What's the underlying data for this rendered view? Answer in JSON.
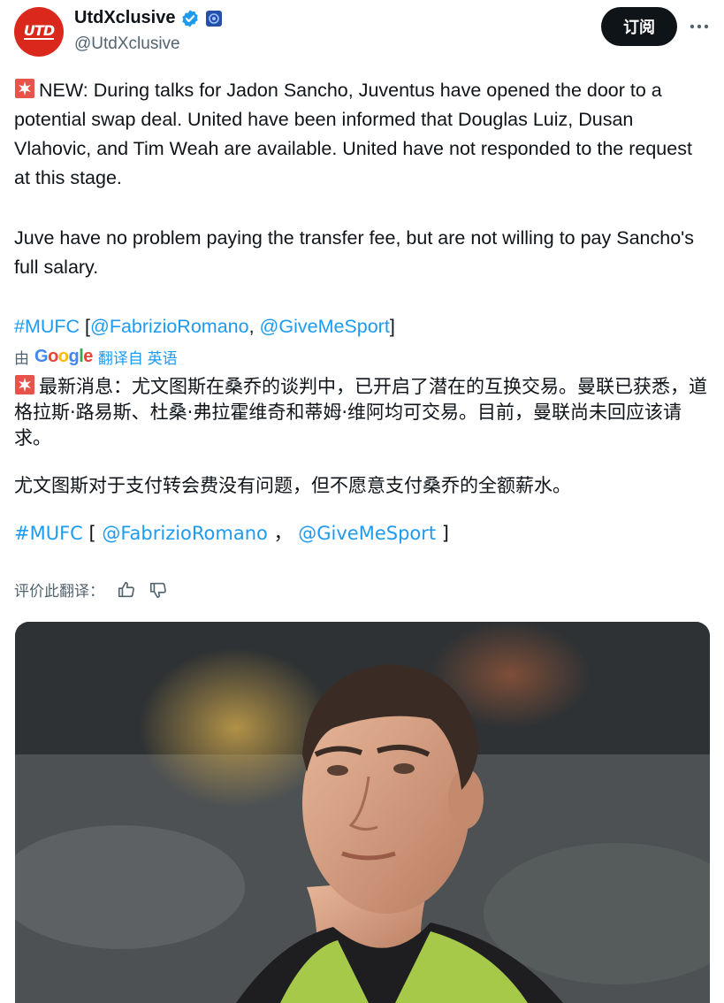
{
  "author": {
    "display_name": "UtdXclusive",
    "handle": "@UtdXclusive",
    "avatar_text": "UTD",
    "verified_icon": "verified-badge-icon",
    "affiliate_icon": "affiliate-badge-icon"
  },
  "header": {
    "subscribe_label": "订阅",
    "more_icon": "more-options-icon"
  },
  "tweet": {
    "p1_text": "NEW: During talks for Jadon Sancho, Juventus have opened the door to a potential swap deal. United have been informed that Douglas Luiz, Dusan Vlahovic, and Tim Weah are available. United have not responded to the request at this stage.",
    "p2_text": "Juve have no problem paying the transfer fee, but are not willing to pay Sancho's full salary.",
    "hashtag": "#MUFC",
    "bracket_open": " [",
    "mention1": "@FabrizioRomano",
    "comma": ", ",
    "mention2": "@GiveMeSport",
    "bracket_close": "]"
  },
  "translation": {
    "by_label": "由",
    "google": [
      "G",
      "o",
      "o",
      "g",
      "l",
      "e"
    ],
    "translated_from": "翻译自 英语",
    "zh_p1": "最新消息：尤文图斯在桑乔的谈判中，已开启了潜在的互换交易。曼联已获悉，道格拉斯·路易斯、杜桑·弗拉霍维奇和蒂姆·维阿均可交易。目前，曼联尚未回应该请求。",
    "zh_p2": "尤文图斯对于支付转会费没有问题，但不愿意支付桑乔的全额薪水。",
    "zh_hashtag": "#MUFC",
    "zh_open": " [ ",
    "zh_mention1": "@FabrizioRomano",
    "zh_sep": " ，  ",
    "zh_mention2": "@GiveMeSport",
    "zh_close": " ]",
    "rate_label": "评价此翻译：",
    "thumbs_up_icon": "thumbs-up-icon",
    "thumbs_down_icon": "thumbs-down-icon"
  },
  "colors": {
    "link": "#1d9bf0",
    "avatar_bg": "#da291c",
    "verified": "#1d9bf0",
    "button_bg": "#0f1419"
  },
  "media": {
    "alt": "photo of a footballer in a green training bib"
  }
}
